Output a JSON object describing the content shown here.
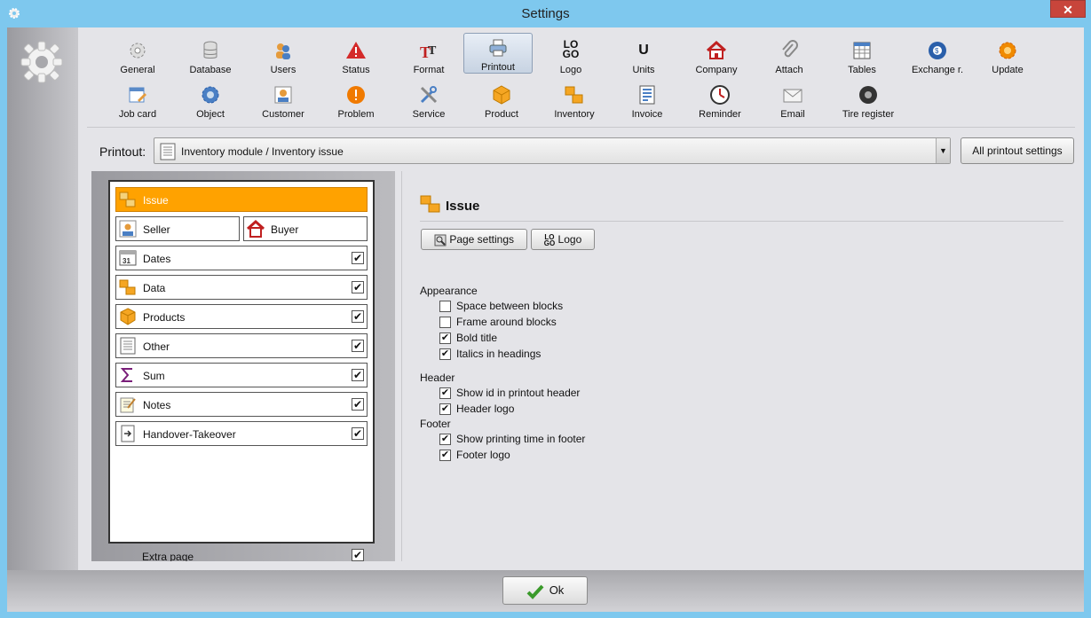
{
  "window": {
    "title": "Settings",
    "close_label": "✕"
  },
  "toolbar": {
    "row1": [
      "General",
      "Database",
      "Users",
      "Status",
      "Format",
      "Printout",
      "Logo",
      "Units",
      "Company",
      "Attach",
      "Tables",
      "Exchange r.",
      "Update"
    ],
    "row2": [
      "Job card",
      "Object",
      "Customer",
      "Problem",
      "Service",
      "Product",
      "Inventory",
      "Invoice",
      "Reminder",
      "Email",
      "Tire register"
    ],
    "active": "Printout",
    "logo_glyph_top": "LO",
    "logo_glyph_bottom": "GO",
    "units_glyph": "U"
  },
  "printout": {
    "label": "Printout:",
    "selected": "Inventory module / Inventory issue",
    "all_button": "All printout settings"
  },
  "blocks": {
    "issue": "Issue",
    "seller": "Seller",
    "buyer": "Buyer",
    "dates": "Dates",
    "data": "Data",
    "products": "Products",
    "other": "Other",
    "sum": "Sum",
    "notes": "Notes",
    "handover": "Handover-Takeover",
    "extra_page": "Extra page",
    "dates_icon_text": "31",
    "check": "✔"
  },
  "section": {
    "title": "Issue",
    "page_settings": "Page settings",
    "logo_button": "Logo",
    "appearance": "Appearance",
    "appearance_opts": [
      {
        "label": "Space between blocks",
        "checked": false
      },
      {
        "label": "Frame around blocks",
        "checked": false
      },
      {
        "label": "Bold title",
        "checked": true
      },
      {
        "label": "Italics in headings",
        "checked": true
      }
    ],
    "header": "Header",
    "header_opts": [
      {
        "label": "Show id in printout header",
        "checked": true
      },
      {
        "label": "Header logo",
        "checked": true
      }
    ],
    "footer": "Footer",
    "footer_opts": [
      {
        "label": "Show printing time in footer",
        "checked": true
      },
      {
        "label": "Footer logo",
        "checked": true
      }
    ]
  },
  "footer_bar": {
    "ok": "Ok"
  },
  "colors": {
    "selected_block": "#ffa200",
    "accent": "#7ec8ee"
  }
}
